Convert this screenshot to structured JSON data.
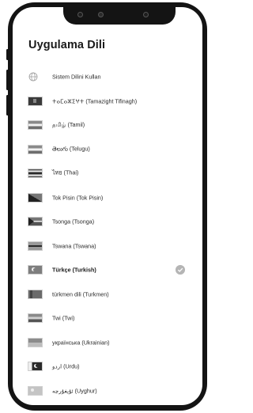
{
  "header": {
    "title": "Uygulama Dili"
  },
  "languages": {
    "items": [
      {
        "label": "Sistem Dilini Kullan",
        "icon": "globe-icon"
      },
      {
        "label": "ⵜⴰⵎⴰⵣⵉⵖⵜ (Tamazight Tifinagh)"
      },
      {
        "label": "தமிழ் (Tamil)"
      },
      {
        "label": "తెలుగు (Telugu)"
      },
      {
        "label": "ไทย (Thai)"
      },
      {
        "label": "Tok Pisin (Tok Pisin)"
      },
      {
        "label": "Tsonga (Tsonga)"
      },
      {
        "label": "Tswana (Tswana)"
      },
      {
        "label": "Türkçe (Turkish)",
        "selected": true
      },
      {
        "label": "türkmen dili (Turkmen)"
      },
      {
        "label": "Twi (Twi)"
      },
      {
        "label": "українська (Ukrainian)"
      },
      {
        "label": "اردو (Urdu)"
      },
      {
        "label": "ئۇيغۇرچە (Uyghur)"
      }
    ]
  }
}
